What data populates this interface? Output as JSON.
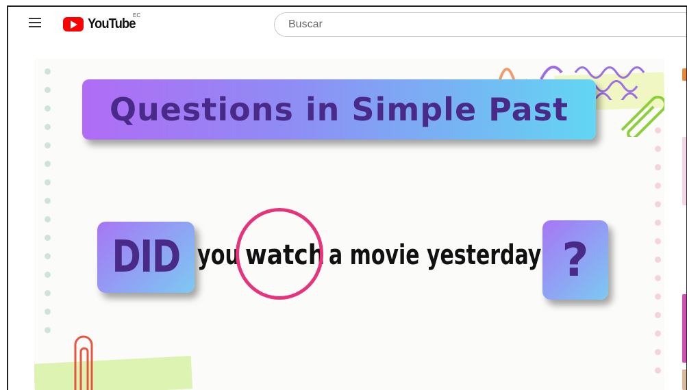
{
  "header": {
    "logo_text": "YouTube",
    "region_code": "EC",
    "search_placeholder": "Buscar"
  },
  "video": {
    "title": "Questions in Simple Past",
    "did": "DID",
    "word_you": "you",
    "word_watch": "watch",
    "word_rest": "a movie yesterday",
    "question_mark": "?"
  },
  "colors": {
    "youtube_red": "#ff0000",
    "gradient_start": "#b06cf5",
    "gradient_end": "#62d6f3",
    "title_text": "#4a2a88",
    "circle": "#e8337b"
  },
  "icons": [
    "menu-icon",
    "youtube-play-icon",
    "paperclip-icon",
    "squiggle-decoration"
  ]
}
